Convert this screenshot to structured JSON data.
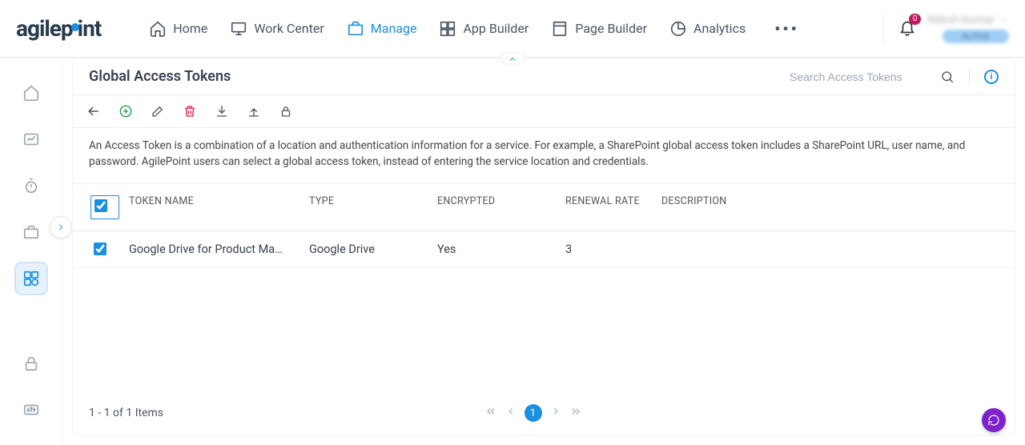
{
  "top_nav": {
    "items": [
      {
        "label": "Home"
      },
      {
        "label": "Work Center"
      },
      {
        "label": "Manage",
        "active": true
      },
      {
        "label": "App Builder"
      },
      {
        "label": "Page Builder"
      },
      {
        "label": "Analytics"
      }
    ]
  },
  "notifications": {
    "count": "0"
  },
  "user": {
    "name": "Nilesh Kumar",
    "tag": "ALPHA"
  },
  "page": {
    "title": "Global Access Tokens",
    "search_placeholder": "Search Access Tokens",
    "description": "An Access Token is a combination of a location and authentication information for a service. For example, a SharePoint global access token includes a SharePoint URL, user name, and password. AgilePoint users can select a global access token, instead of entering the service location and credentials."
  },
  "table": {
    "headers": {
      "name": "TOKEN NAME",
      "type": "TYPE",
      "encrypted": "ENCRYPTED",
      "renewal": "RENEWAL RATE",
      "description": "DESCRIPTION"
    },
    "rows": [
      {
        "checked": true,
        "name": "Google Drive for Product Ma…",
        "type": "Google Drive",
        "encrypted": "Yes",
        "renewal": "3",
        "description": ""
      }
    ]
  },
  "footer": {
    "range": "1 - 1 of 1 Items",
    "page": "1"
  }
}
